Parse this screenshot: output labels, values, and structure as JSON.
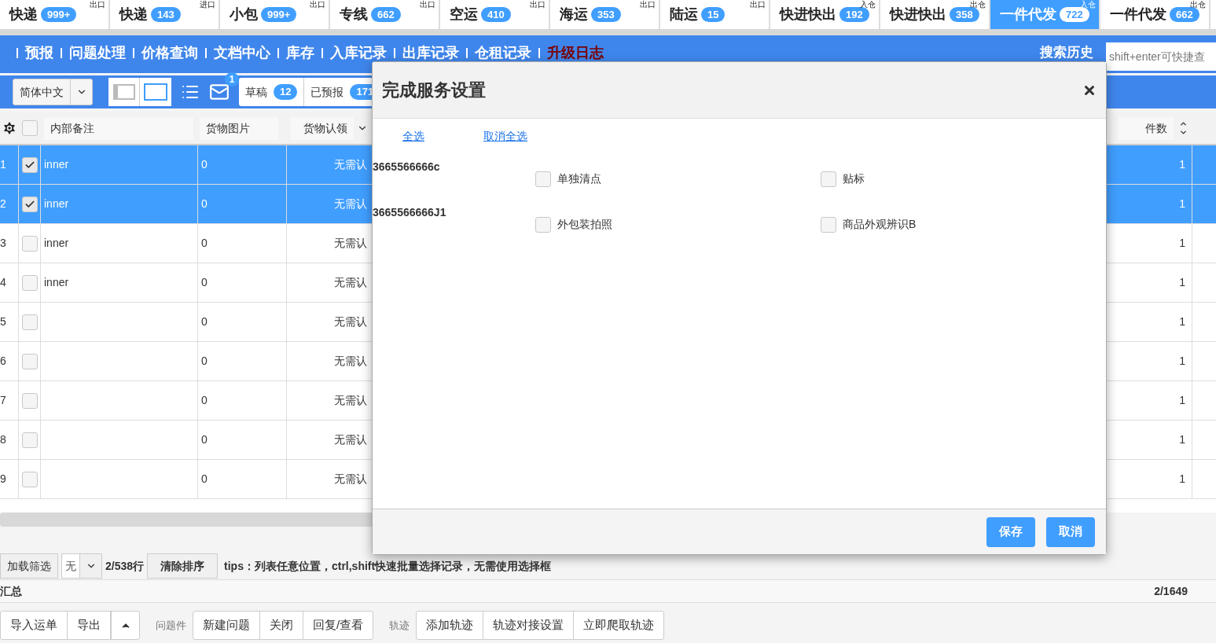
{
  "tabs": [
    {
      "label": "快递",
      "count": "999+",
      "tag": "出口",
      "selected": false
    },
    {
      "label": "快递",
      "count": "143",
      "tag": "进口",
      "selected": false
    },
    {
      "label": "小包",
      "count": "999+",
      "tag": "出口",
      "selected": false
    },
    {
      "label": "专线",
      "count": "662",
      "tag": "出口",
      "selected": false
    },
    {
      "label": "空运",
      "count": "410",
      "tag": "出口",
      "selected": false
    },
    {
      "label": "海运",
      "count": "353",
      "tag": "出口",
      "selected": false
    },
    {
      "label": "陆运",
      "count": "15",
      "tag": "出口",
      "selected": false
    },
    {
      "label": "快进快出",
      "count": "192",
      "tag": "入仓",
      "selected": false
    },
    {
      "label": "快进快出",
      "count": "358",
      "tag": "出仓",
      "selected": false
    },
    {
      "label": "一件代发",
      "count": "722",
      "tag": "入仓",
      "selected": true
    },
    {
      "label": "一件代发",
      "count": "662",
      "tag": "出仓",
      "selected": false
    }
  ],
  "nav": [
    {
      "label": "预报",
      "kind": "normal"
    },
    {
      "label": "问题处理",
      "kind": "normal"
    },
    {
      "label": "价格查询",
      "kind": "normal"
    },
    {
      "label": "文档中心",
      "kind": "normal"
    },
    {
      "label": "库存",
      "kind": "normal"
    },
    {
      "label": "入库记录",
      "kind": "normal"
    },
    {
      "label": "出库记录",
      "kind": "normal"
    },
    {
      "label": "仓租记录",
      "kind": "normal"
    },
    {
      "label": "升级日志",
      "kind": "alert"
    }
  ],
  "search": {
    "history": "搜索历史",
    "placeholder": "shift+enter可快捷查"
  },
  "toolbar": {
    "language": "简体中文",
    "mail_badge": "1",
    "counters": [
      {
        "label": "草稿",
        "count": "12"
      },
      {
        "label": "已预报",
        "count": "171"
      }
    ]
  },
  "table": {
    "all_checked": false,
    "columns": [
      "内部备注",
      "货物图片",
      "货物认领"
    ],
    "right_column": "件数",
    "rows": [
      {
        "number": "1",
        "selected": true,
        "checked": true,
        "note": "inner",
        "images": "0",
        "claim": "无需认",
        "pieces": "1"
      },
      {
        "number": "2",
        "selected": true,
        "checked": true,
        "note": "inner",
        "images": "0",
        "claim": "无需认",
        "pieces": "1"
      },
      {
        "number": "3",
        "selected": false,
        "checked": false,
        "note": "inner",
        "images": "0",
        "claim": "无需认",
        "pieces": "1"
      },
      {
        "number": "4",
        "selected": false,
        "checked": false,
        "note": "inner",
        "images": "0",
        "claim": "无需认",
        "pieces": "1"
      },
      {
        "number": "5",
        "selected": false,
        "checked": false,
        "images": "0",
        "claim": "无需认",
        "pieces": "1"
      },
      {
        "number": "6",
        "selected": false,
        "checked": false,
        "images": "0",
        "claim": "无需认",
        "pieces": "1"
      },
      {
        "number": "7",
        "selected": false,
        "checked": false,
        "images": "0",
        "claim": "无需认",
        "pieces": "1"
      },
      {
        "number": "8",
        "selected": false,
        "checked": false,
        "images": "0",
        "claim": "无需认",
        "pieces": "1"
      },
      {
        "number": "9",
        "selected": false,
        "checked": false,
        "images": "0",
        "claim": "无需认",
        "pieces": "1"
      }
    ]
  },
  "filter_bar": {
    "load_button": "加载筛选",
    "select_value": "无",
    "row_count": "2/538行",
    "clear_sort": "清除排序",
    "tips": "tips：列表任意位置，ctrl,shift快速批量选择记录，无需使用选择框"
  },
  "summary": {
    "label": "汇总",
    "total": "2/1649"
  },
  "actions": [
    {
      "buttons": [
        "导入运单",
        "导出"
      ],
      "has_toggle": true
    },
    {
      "label": "问题件",
      "buttons": [
        "新建问题",
        "关闭",
        "回复/查看"
      ]
    },
    {
      "label": "轨迹",
      "buttons": [
        "添加轨迹",
        "轨迹对接设置",
        "立即爬取轨迹"
      ]
    }
  ],
  "modal": {
    "title": "完成服务设置",
    "select_all": "全选",
    "deselect_all": "取消全选",
    "groups": [
      {
        "code": "3665566666c",
        "options": [
          {
            "label": "单独清点",
            "checked": false
          },
          {
            "label": "贴标",
            "checked": false
          }
        ]
      },
      {
        "code": "3665566666J1",
        "options": [
          {
            "label": "外包装拍照",
            "checked": false
          },
          {
            "label": "商品外观辨识B",
            "checked": false
          }
        ]
      }
    ],
    "buttons": [
      "保存",
      "取消"
    ]
  }
}
